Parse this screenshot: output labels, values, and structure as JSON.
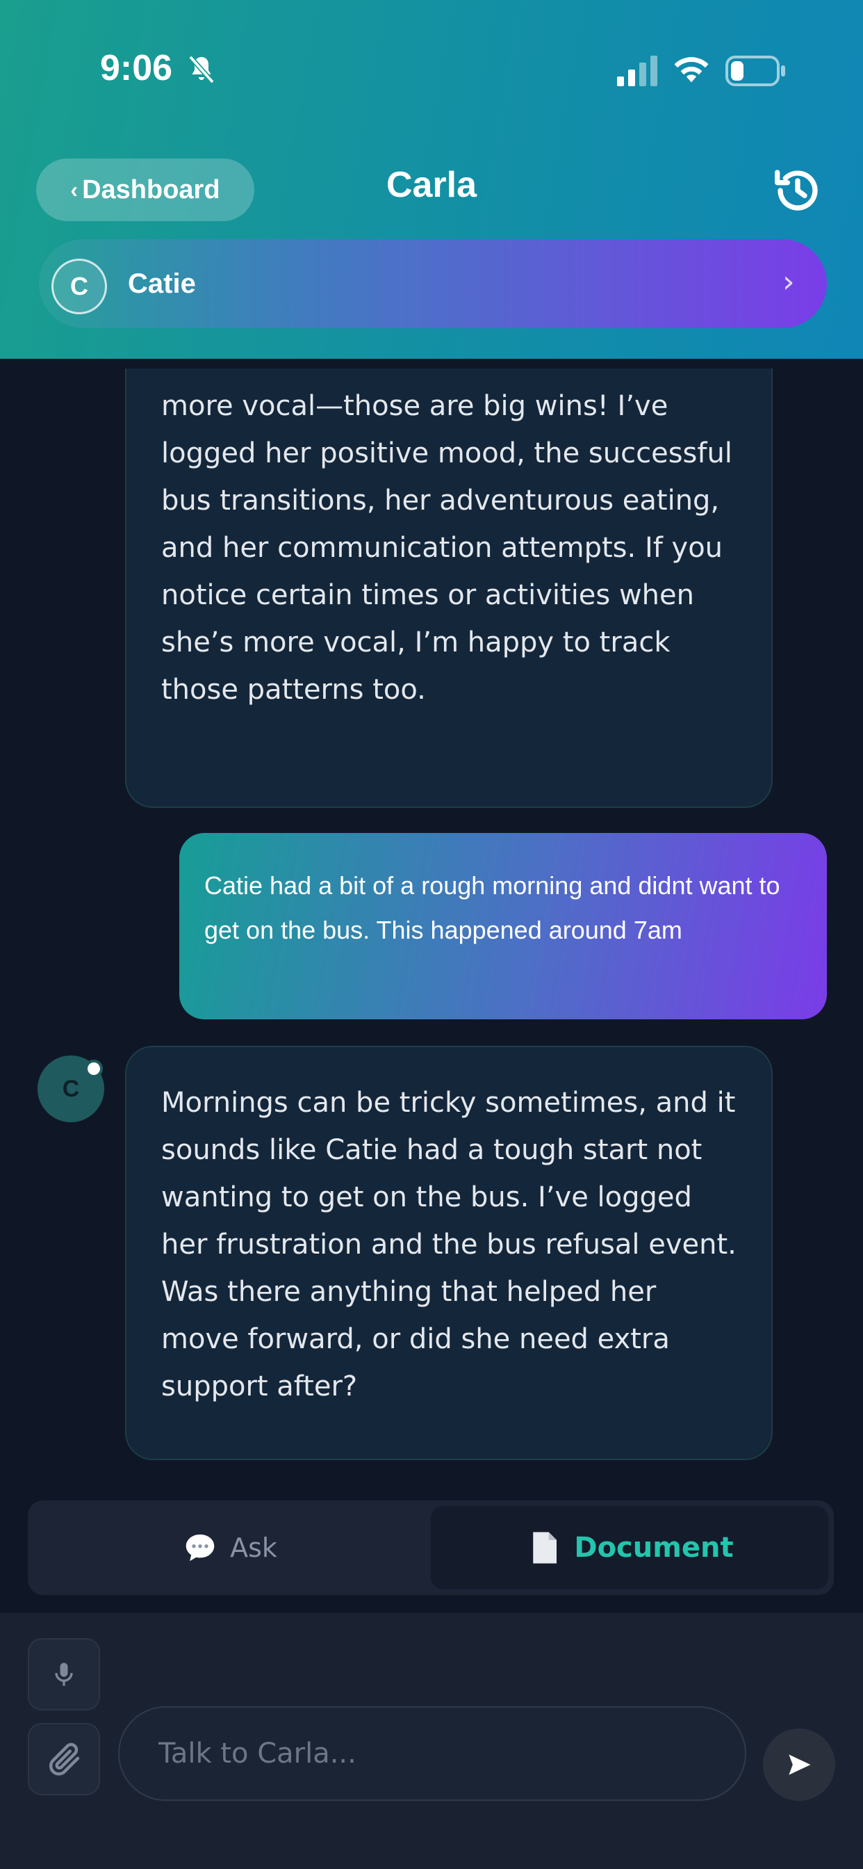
{
  "status_bar": {
    "time": "9:06"
  },
  "header": {
    "back_label": "Dashboard",
    "title": "Carla"
  },
  "child": {
    "initial": "C",
    "name": "Catie"
  },
  "messages": [
    {
      "role": "assistant",
      "text": "more vocal—those are big wins! I’ve logged her positive mood, the successful bus transitions, her adventurous eating, and her communication attempts. If you notice certain times or activities when she’s more vocal, I’m happy to track those patterns too."
    },
    {
      "role": "user",
      "text": "Catie had a bit of a rough morning and didnt want to get on the bus. This happened around 7am"
    },
    {
      "role": "assistant",
      "avatar_initial": "C",
      "text": "Mornings can be tricky sometimes, and it sounds like Catie had a tough start not wanting to get on the bus. I’ve logged her frustration and the bus refusal event. Was there anything that helped her move forward, or did she need extra support after?"
    }
  ],
  "mode_toggle": {
    "ask_label": "Ask",
    "document_label": "Document",
    "active": "Document",
    "active_color": "#23c5ad"
  },
  "composer": {
    "placeholder": "Talk to Carla...",
    "value": ""
  },
  "colors": {
    "background": "#0f1727",
    "header_start": "#1a9e8e",
    "header_end": "#0f86b6",
    "user_bubble_start": "#179d96",
    "user_bubble_end": "#7a3ce8"
  }
}
